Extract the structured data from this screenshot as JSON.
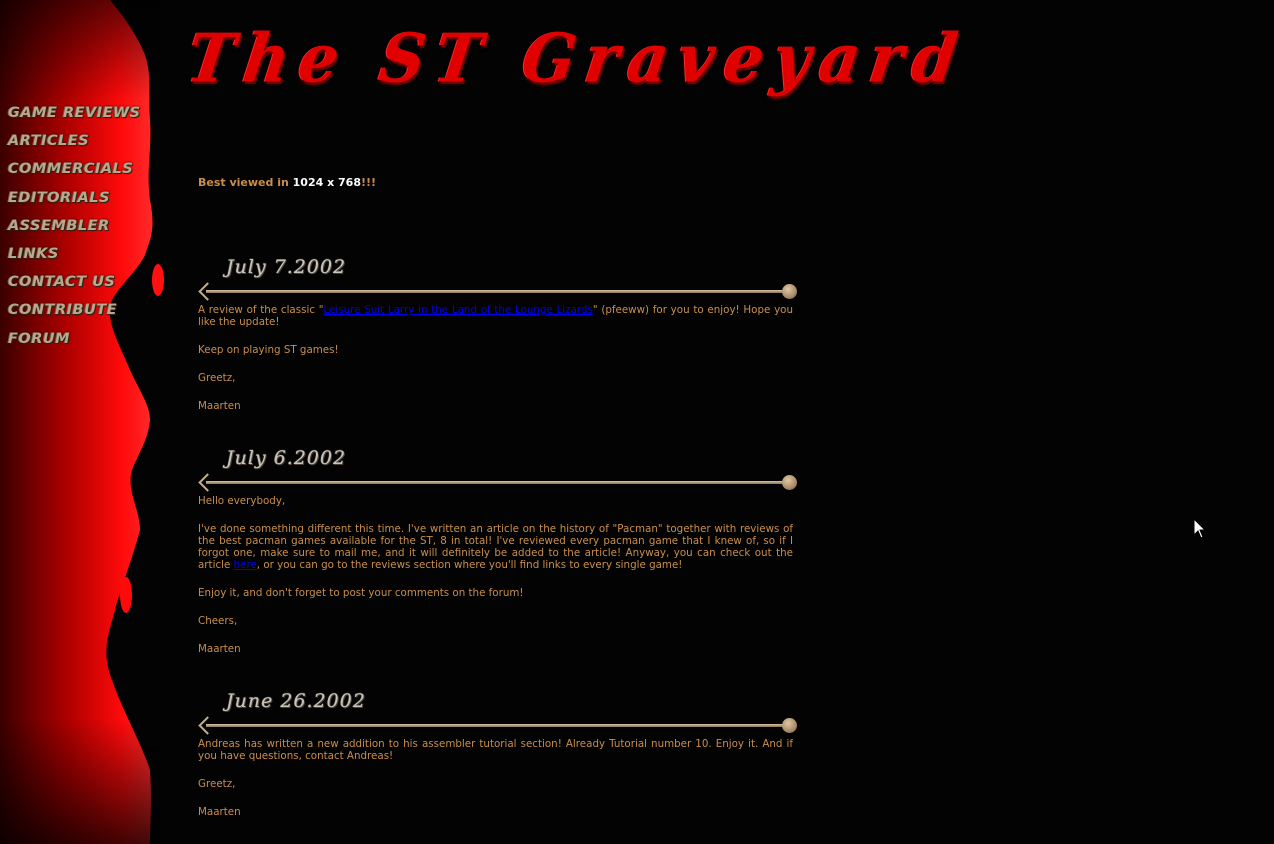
{
  "site": {
    "title": "The ST Graveyard",
    "best_viewed_prefix": "Best viewed in ",
    "best_viewed_resolution": "1024 x 768",
    "best_viewed_suffix": "!!!"
  },
  "menu": {
    "items": [
      {
        "label": "GAME REVIEWS"
      },
      {
        "label": "ARTICLES"
      },
      {
        "label": "COMMERCIALS"
      },
      {
        "label": "EDITORIALS"
      },
      {
        "label": "ASSEMBLER"
      },
      {
        "label": "LINKS"
      },
      {
        "label": "CONTACT US"
      },
      {
        "label": "CONTRIBUTE"
      },
      {
        "label": "FORUM"
      }
    ]
  },
  "news": [
    {
      "date": "July 7.2002",
      "p1_before": "A review of the classic \"",
      "p1_link": "Leisure Suit Larry in the Land of the Lounge Lizards",
      "p1_after": "\" (pfeeww) for you to enjoy! Hope you like the update!",
      "p2": "Keep on playing ST games!",
      "p3": "Greetz,",
      "p4": "Maarten"
    },
    {
      "date": "July 6.2002",
      "p1": "Hello everybody,",
      "p2_before": "I've done something different this time. I've written an article on the history of \"Pacman\" together with reviews of the best pacman games available for the ST, 8 in total! I've reviewed every pacman game that I knew of, so if I forgot one, make sure to mail me, and it will definitely be added to the article! Anyway, you can check out the article ",
      "p2_link": "here",
      "p2_after": ", or you can go to the reviews section where you'll find links to every single game!",
      "p3": "Enjoy it, and don't forget to post your comments on the forum!",
      "p4": "Cheers,",
      "p5": "Maarten"
    },
    {
      "date": "June 26.2002",
      "p1": "Andreas has written a new addition to his assembler tutorial section! Already Tutorial number 10. Enjoy it. And if you have questions, contact Andreas!",
      "p2": "Greetz,",
      "p3": "Maarten"
    }
  ],
  "colors": {
    "background": "#030303",
    "blood_red": "#e00000",
    "news_text": "#c98e4d",
    "link": "#0000ee",
    "menu_text": "#bba78c"
  },
  "icons": {
    "cursor": "mouse-pointer-icon",
    "divider": "arrow-divider-icon"
  }
}
